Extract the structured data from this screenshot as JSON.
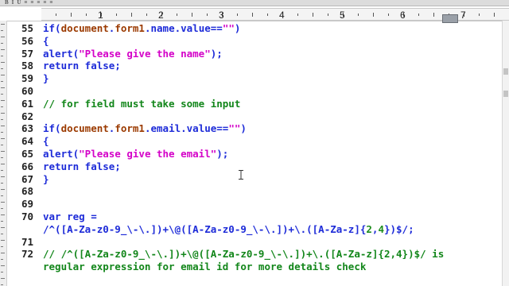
{
  "toolbar": {
    "buttons": [
      "B",
      "I",
      "U",
      "≡",
      "≡",
      "≡",
      "≡",
      "≡"
    ]
  },
  "ruler": {
    "numbers": [
      "1",
      "2",
      "3",
      "4",
      "5",
      "6",
      "7"
    ]
  },
  "colors": {
    "keyword": "#1d2bd8",
    "object": "#9b3a00",
    "string": "#d400c8",
    "number": "#1c8c1c",
    "comment": "#12861a"
  },
  "editor": {
    "lines": [
      {
        "number": "55",
        "segments": [
          [
            "k",
            "if("
          ],
          [
            "o",
            "document"
          ],
          [
            "k",
            "."
          ],
          [
            "o",
            "form1"
          ],
          [
            "k",
            ".name.value=="
          ],
          [
            "s",
            "\"\""
          ],
          [
            "k",
            ")"
          ]
        ]
      },
      {
        "number": "56",
        "segments": [
          [
            "k",
            "{"
          ]
        ]
      },
      {
        "number": "57",
        "segments": [
          [
            "k",
            "alert("
          ],
          [
            "s",
            "\"Please give the name\""
          ],
          [
            "k",
            ");"
          ]
        ]
      },
      {
        "number": "58",
        "segments": [
          [
            "k",
            "return false;"
          ]
        ]
      },
      {
        "number": "59",
        "segments": [
          [
            "k",
            "}"
          ]
        ]
      },
      {
        "number": "60",
        "segments": []
      },
      {
        "number": "61",
        "segments": [
          [
            "cm",
            "// for field must take some input"
          ]
        ]
      },
      {
        "number": "62",
        "segments": []
      },
      {
        "number": "63",
        "segments": [
          [
            "k",
            "if("
          ],
          [
            "o",
            "document"
          ],
          [
            "k",
            "."
          ],
          [
            "o",
            "form1"
          ],
          [
            "k",
            ".email.value=="
          ],
          [
            "s",
            "\"\""
          ],
          [
            "k",
            ")"
          ]
        ]
      },
      {
        "number": "64",
        "segments": [
          [
            "k",
            "{"
          ]
        ]
      },
      {
        "number": "65",
        "segments": [
          [
            "k",
            "alert("
          ],
          [
            "s",
            "\"Please give the email\""
          ],
          [
            "k",
            ");"
          ]
        ]
      },
      {
        "number": "66",
        "segments": [
          [
            "k",
            "return false;"
          ]
        ]
      },
      {
        "number": "67",
        "segments": [
          [
            "k",
            "}"
          ]
        ]
      },
      {
        "number": "68",
        "segments": []
      },
      {
        "number": "69",
        "segments": []
      },
      {
        "number": "70",
        "segments": [
          [
            "k",
            "var reg ="
          ]
        ]
      },
      {
        "number": "",
        "segments": [
          [
            "k",
            "/^([A-Za-z0-9_\\-\\.])+\\@([A-Za-z0-9_\\-\\.])+\\.([A-Za-z]{"
          ],
          [
            "n",
            "2"
          ],
          [
            "k",
            ","
          ],
          [
            "n",
            "4"
          ],
          [
            "k",
            "})$/;"
          ]
        ]
      },
      {
        "number": "71",
        "segments": []
      },
      {
        "number": "72",
        "segments": [
          [
            "cm",
            "// /^([A-Za-z0-9_\\-\\.])+\\@([A-Za-z0-9_\\-\\.])+\\.([A-Za-z]{2,4})$/ is"
          ]
        ]
      },
      {
        "number": "",
        "segments": [
          [
            "cm",
            "regular expression for email id for more details check"
          ]
        ]
      }
    ]
  }
}
